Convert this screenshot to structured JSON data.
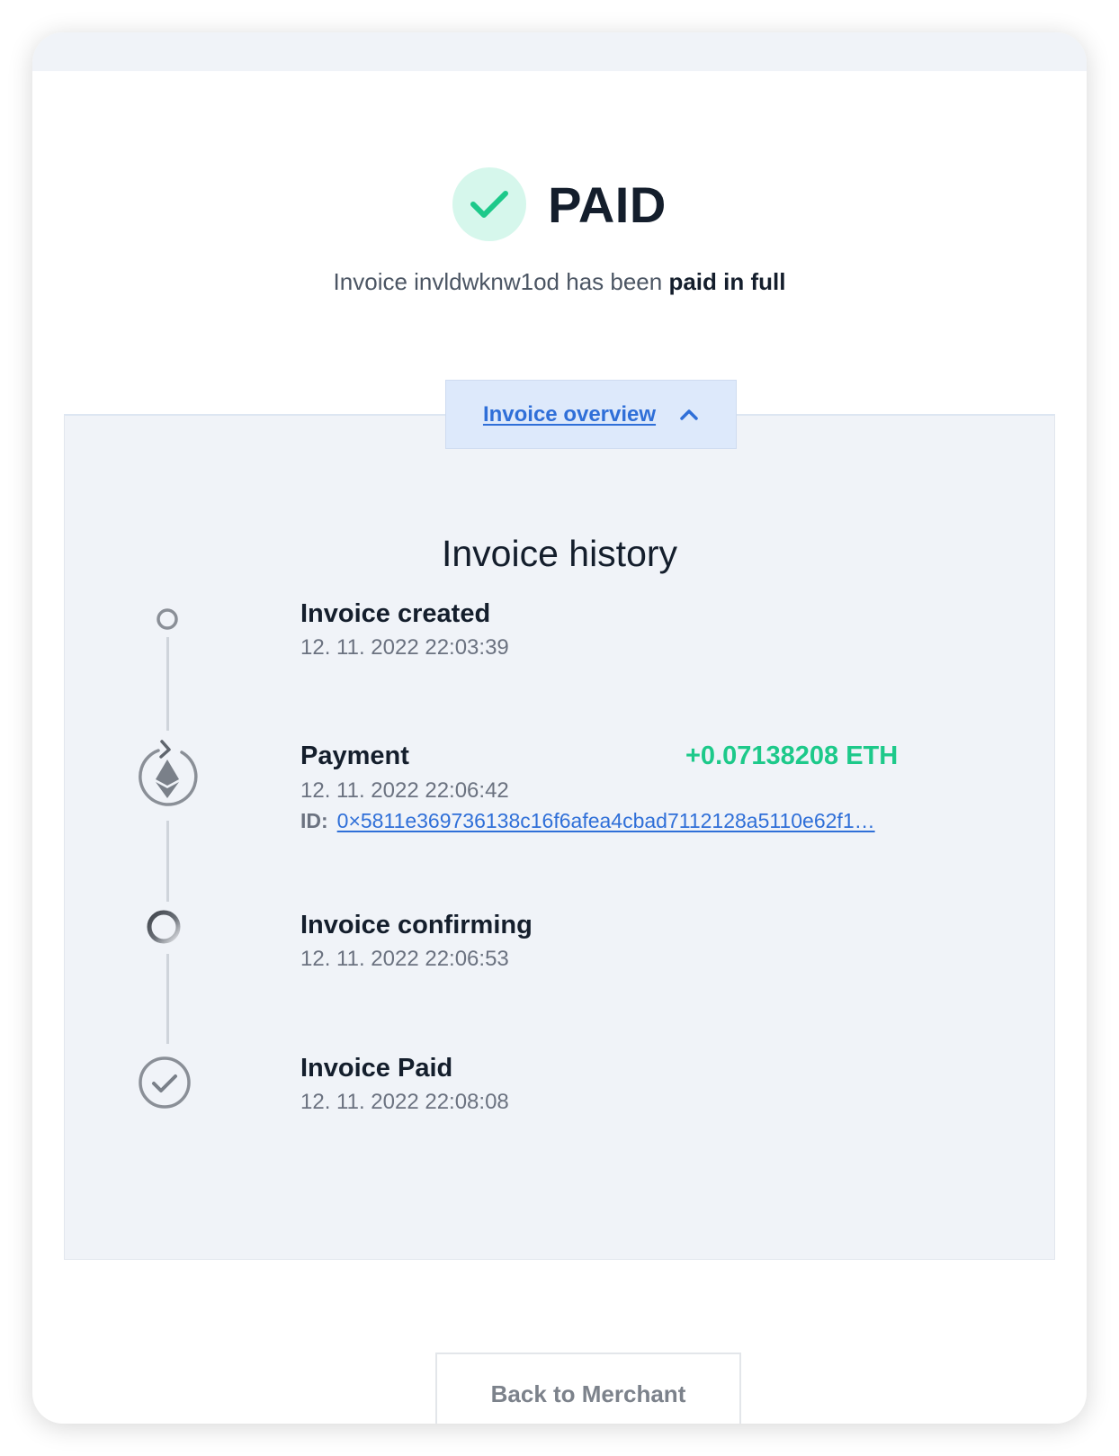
{
  "status": {
    "title": "PAID",
    "subtitle_prefix": "Invoice invldwknw1od has been ",
    "subtitle_bold": "paid in full",
    "icon": "check-icon",
    "accent_color": "#1dc98a"
  },
  "overview_toggle": {
    "label": "Invoice overview",
    "icon": "chevron-up-icon"
  },
  "history": {
    "title": "Invoice history",
    "events": [
      {
        "title": "Invoice created",
        "time": "12. 11. 2022 22:03:39",
        "icon": "circle-dot-icon"
      },
      {
        "title": "Payment",
        "time": "12. 11. 2022 22:06:42",
        "amount": "+0.07138208 ETH",
        "id_label": "ID:",
        "id_value": "0×5811e369736138c16f6afea4cbad7112128a5110e62f1…",
        "icon": "ethereum-icon"
      },
      {
        "title": "Invoice confirming",
        "time": "12. 11. 2022 22:06:53",
        "icon": "spinner-icon"
      },
      {
        "title": "Invoice Paid",
        "time": "12. 11. 2022 22:08:08",
        "icon": "check-circle-icon"
      }
    ]
  },
  "actions": {
    "back_label": "Back to Merchant"
  }
}
